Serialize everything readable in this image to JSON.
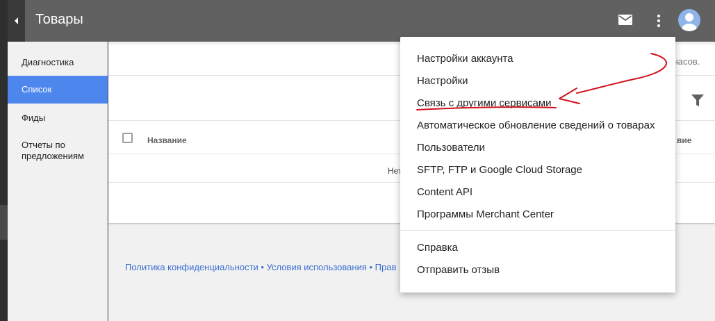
{
  "header": {
    "title": "Товары"
  },
  "icons": {
    "back": "back-arrow-icon",
    "mail": "mail-icon",
    "more": "more-vertical-icon",
    "avatar": "avatar-icon",
    "filter": "filter-icon"
  },
  "sidebar": {
    "items": [
      {
        "label": "Диагностика",
        "active": false
      },
      {
        "label": "Список",
        "active": true
      },
      {
        "label": "Фиды",
        "active": false
      },
      {
        "label": "Отчеты по предложениям",
        "active": false
      }
    ]
  },
  "main": {
    "partial_status_text": "часов.",
    "table": {
      "columns": [
        "Название",
        "вие"
      ],
      "empty_text": "Нет"
    },
    "footer": {
      "links": [
        "Политика конфиденциальности",
        "Условия использования",
        "Прав"
      ],
      "separator": " • "
    }
  },
  "menu": {
    "items": [
      "Настройки аккаунта",
      "Настройки",
      "Связь с другими сервисами",
      "Автоматическое обновление сведений о товарах",
      "Пользователи",
      "SFTP, FTP и Google Cloud Storage",
      "Content API",
      "Программы Merchant Center"
    ],
    "secondary_items": [
      "Справка",
      "Отправить отзыв"
    ],
    "highlighted_item": "Связь с другими сервисами"
  },
  "colors": {
    "topbar": "#616161",
    "sidebar_active": "#4d86ec",
    "link": "#3b6fd1",
    "annotation": "#d0121b"
  }
}
